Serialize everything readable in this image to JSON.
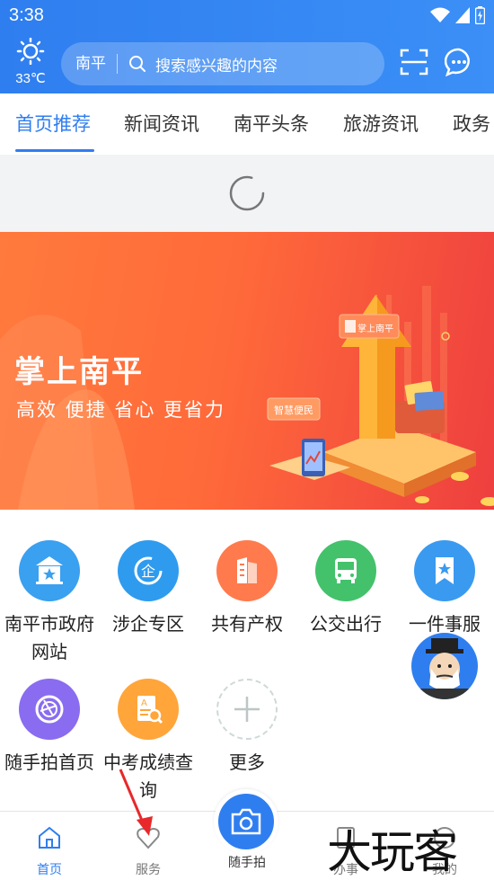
{
  "status": {
    "time": "3:38"
  },
  "weather": {
    "temp": "33℃"
  },
  "search": {
    "city": "南平",
    "placeholder": "搜索感兴趣的内容"
  },
  "tabs": [
    {
      "label": "首页推荐",
      "active": true
    },
    {
      "label": "新闻资讯"
    },
    {
      "label": "南平头条"
    },
    {
      "label": "旅游资讯"
    },
    {
      "label": "政务"
    }
  ],
  "banner": {
    "title": "掌上南平",
    "subtitle": "高效 便捷 省心 更省力",
    "card_label": "掌上南平",
    "tag_label": "智慧便民"
  },
  "services": [
    {
      "label": "南平市政府网站",
      "icon": "government-building-icon",
      "color": "#3aa0f0"
    },
    {
      "label": "涉企专区",
      "icon": "enterprise-icon",
      "color": "#2f9bee"
    },
    {
      "label": "共有产权",
      "icon": "buildings-icon",
      "color": "#ff7a4d"
    },
    {
      "label": "公交出行",
      "icon": "bus-icon",
      "color": "#43c26b"
    },
    {
      "label": "一件事服",
      "icon": "bookmark-star-icon",
      "color": "#3a9af0"
    },
    {
      "label": "随手拍首页",
      "icon": "camera-aperture-icon",
      "color": "#8a6cf0"
    },
    {
      "label": "中考成绩查询",
      "icon": "score-search-icon",
      "color": "#ffa53a"
    },
    {
      "label": "更多",
      "icon": "plus-icon",
      "color": "#cfd8d8"
    }
  ],
  "bottom_nav": [
    {
      "label": "首页",
      "active": true
    },
    {
      "label": "服务"
    },
    {
      "label": "随手拍"
    },
    {
      "label": "办事"
    },
    {
      "label": "我的"
    }
  ],
  "watermark": "大玩客",
  "colors": {
    "primary": "#2f7ef0",
    "banner_start": "#ff7a3c",
    "banner_end": "#ee3f3f"
  }
}
